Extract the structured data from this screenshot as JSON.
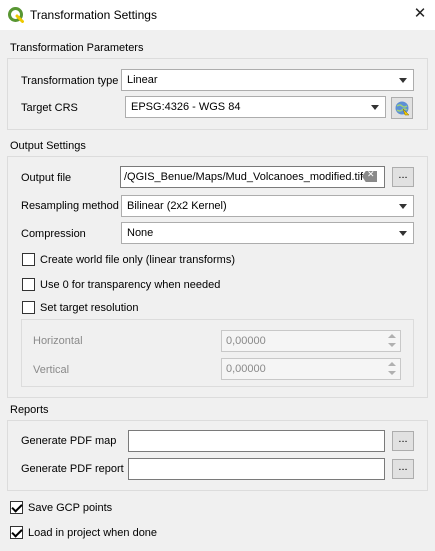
{
  "window": {
    "title": "Transformation Settings",
    "app_icon": "qgis-logo-icon",
    "close_icon": "close-icon"
  },
  "transformation": {
    "section_label": "Transformation Parameters",
    "type_label": "Transformation type",
    "type_value": "Linear",
    "crs_label": "Target CRS",
    "crs_value": "EPSG:4326 - WGS 84",
    "crs_selector_icon": "crs-selector-icon"
  },
  "output": {
    "section_label": "Output Settings",
    "file_label": "Output file",
    "file_value": "/QGIS_Benue/Maps/Mud_Volcanoes_modified.tif",
    "browse_label": "...",
    "resampling_label": "Resampling method",
    "resampling_value": "Bilinear (2x2 Kernel)",
    "compression_label": "Compression",
    "compression_value": "None",
    "world_file_label": "Create world file only (linear transforms)",
    "world_file_checked": false,
    "transparency_label": "Use 0 for transparency when needed",
    "transparency_checked": false,
    "target_res_label": "Set target resolution",
    "target_res_checked": false,
    "horizontal_label": "Horizontal",
    "horizontal_value": "0,00000",
    "vertical_label": "Vertical",
    "vertical_value": "0,00000"
  },
  "reports": {
    "section_label": "Reports",
    "pdf_map_label": "Generate PDF map",
    "pdf_map_value": "",
    "pdf_report_label": "Generate PDF report",
    "pdf_report_value": "",
    "browse_label": "..."
  },
  "options": {
    "save_gcp_label": "Save GCP points",
    "save_gcp_checked": true,
    "load_project_label": "Load in project when done",
    "load_project_checked": true
  },
  "colors": {
    "window_bg": "#f0f0f0",
    "titlebar_bg": "#ffffff",
    "field_border": "#adadad",
    "disabled_text": "#8a8a8a",
    "qgis_green": "#589632",
    "qgis_yellow": "#eec900"
  }
}
